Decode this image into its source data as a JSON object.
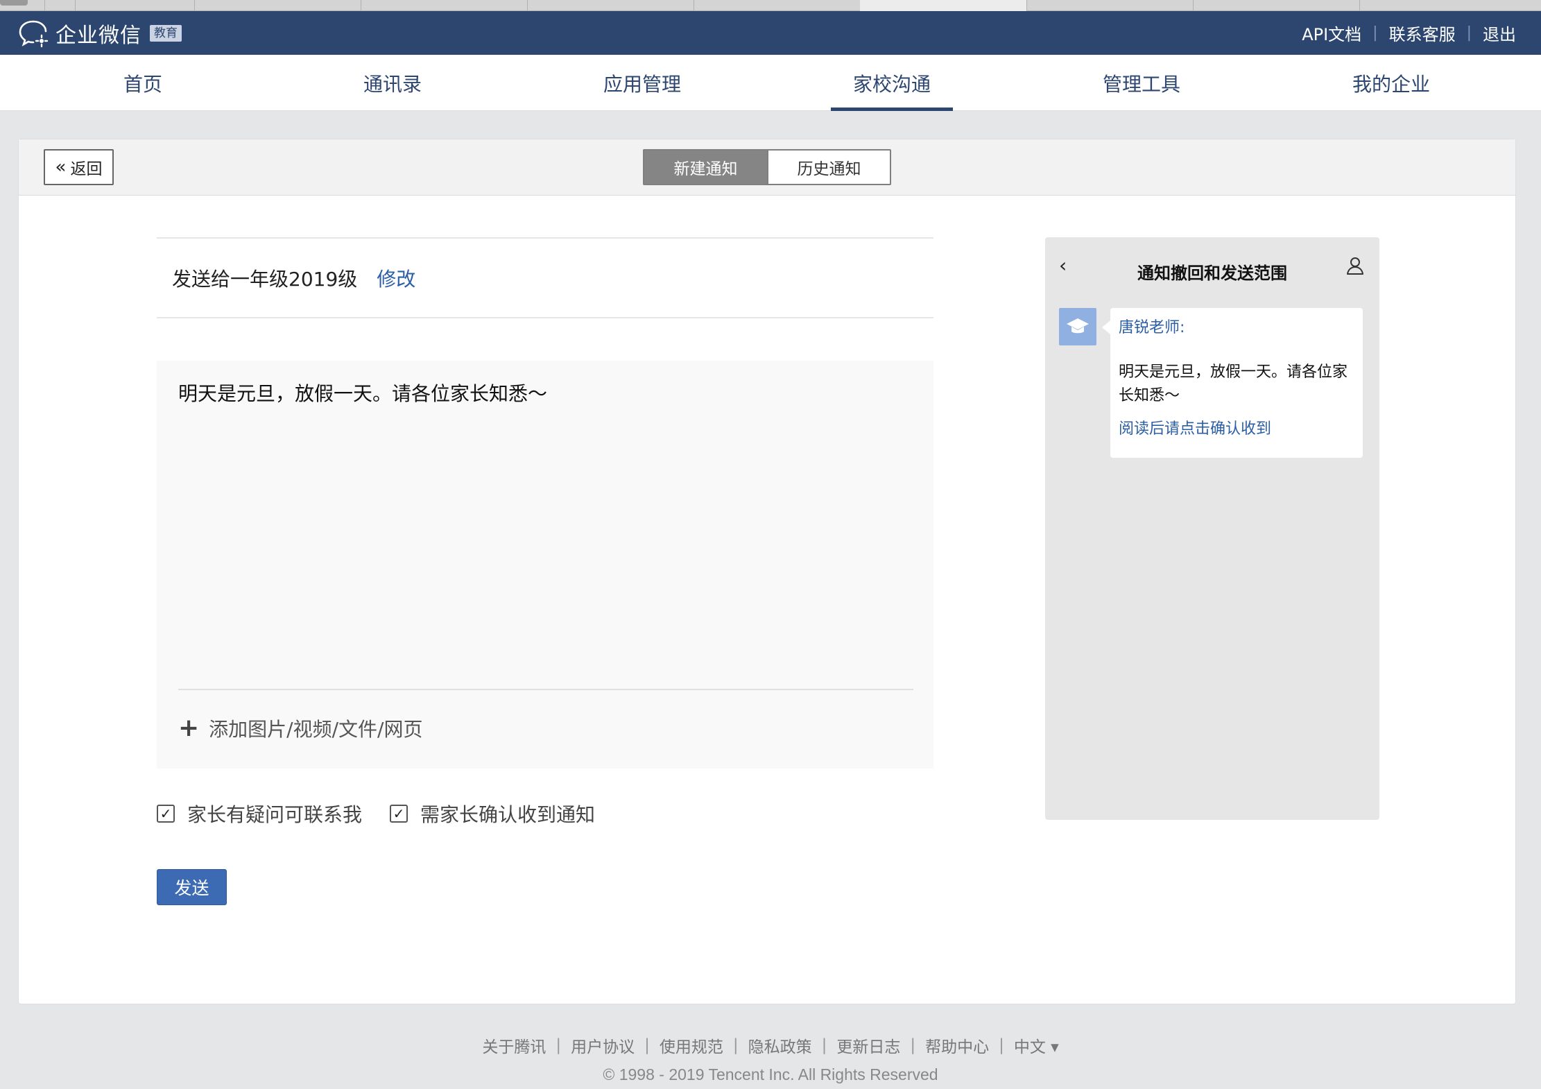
{
  "header": {
    "logo_text": "企业微信",
    "logo_badge": "教育",
    "links": [
      "API文档",
      "联系客服",
      "退出"
    ]
  },
  "nav": {
    "items": [
      "首页",
      "通讯录",
      "应用管理",
      "家校沟通",
      "管理工具",
      "我的企业"
    ],
    "active_index": 3
  },
  "toolbar": {
    "back_label": "返回",
    "segments": [
      "新建通知",
      "历史通知"
    ],
    "active_segment": 0
  },
  "notice": {
    "recipient_text": "发送给一年级2019级",
    "edit_label": "修改",
    "content": "明天是元旦，放假一天。请各位家长知悉～",
    "attach_label": "添加图片/视频/文件/网页",
    "options": [
      {
        "label": "家长有疑问可联系我",
        "checked": true
      },
      {
        "label": "需家长确认收到通知",
        "checked": true
      }
    ],
    "send_label": "发送"
  },
  "preview": {
    "title": "通知撤回和发送范围",
    "sender": "唐锐老师:",
    "message": "明天是元旦，放假一天。请各位家长知悉～",
    "confirm_text": "阅读后请点击确认收到"
  },
  "footer": {
    "links": [
      "关于腾讯",
      "用户协议",
      "使用规范",
      "隐私政策",
      "更新日志",
      "帮助中心",
      "中文 ▾"
    ],
    "copyright": "© 1998 - 2019 Tencent Inc. All Rights Reserved"
  },
  "colors": {
    "header_bg": "#2d4670",
    "accent": "#2b5ea5",
    "send_button": "#3c6bb3",
    "segment_active": "#858585"
  }
}
